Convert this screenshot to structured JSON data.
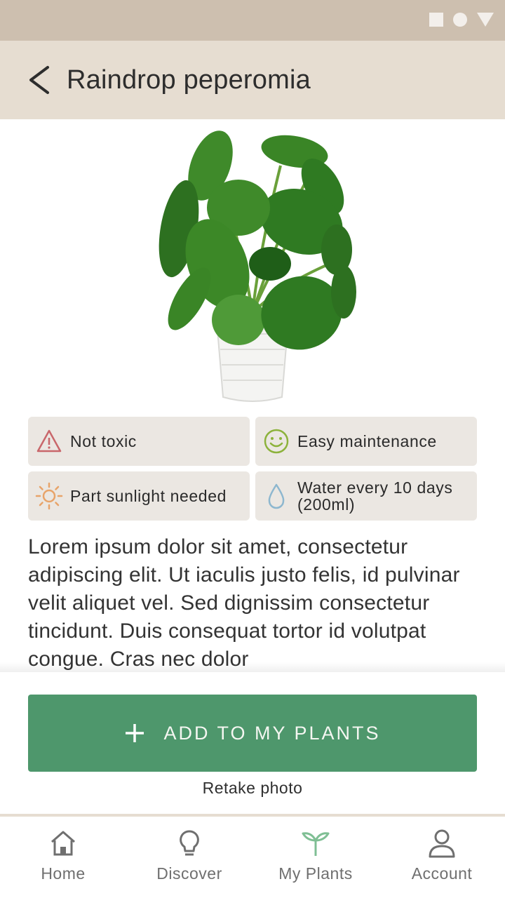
{
  "header": {
    "title": "Raindrop peperomia",
    "back_icon": "chevron-left-icon"
  },
  "chips": [
    {
      "label": "Not toxic",
      "icon": "warning-triangle-icon",
      "color": "#c9676b"
    },
    {
      "label": "Easy maintenance",
      "icon": "smiley-face-icon",
      "color": "#8cb23b"
    },
    {
      "label": "Part sunlight needed",
      "icon": "sun-icon",
      "color": "#e8a46a"
    },
    {
      "label": "Water every 10 days (200ml)",
      "icon": "water-drop-icon",
      "color": "#8db7cf"
    }
  ],
  "description": "Lorem ipsum dolor sit amet, consectetur adipiscing elit. Ut iaculis justo felis, id pulvinar velit aliquet vel. Sed dignissim consectetur tincidunt. Duis consequat tortor id volutpat congue. Cras nec dolor",
  "actions": {
    "add_label": "ADD TO MY PLANTS",
    "retake_label": "Retake photo"
  },
  "nav": [
    {
      "label": "Home",
      "icon": "home-icon"
    },
    {
      "label": "Discover",
      "icon": "lightbulb-icon"
    },
    {
      "label": "My Plants",
      "icon": "sprout-icon",
      "active": true
    },
    {
      "label": "Account",
      "icon": "person-icon"
    }
  ],
  "colors": {
    "status_bar": "#cdbfaf",
    "app_bar": "#e6ddd1",
    "primary_button": "#4e976c",
    "chip_bg": "#ebe7e2",
    "active_nav_icon": "#7fbf94"
  }
}
